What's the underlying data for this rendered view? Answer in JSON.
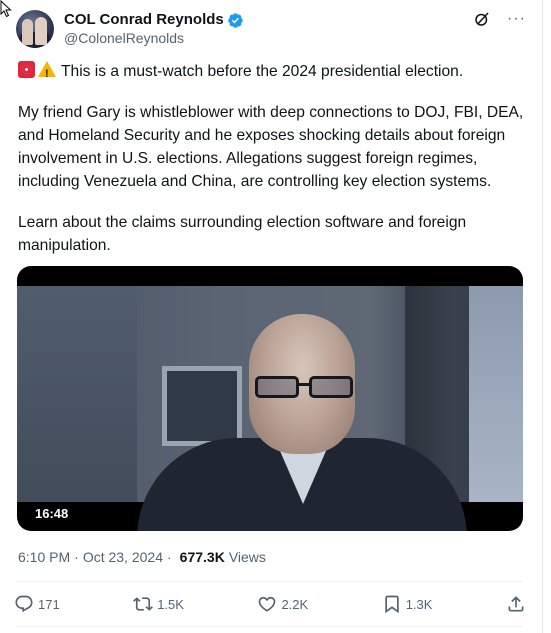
{
  "author": {
    "display_name": "COL Conrad Reynolds",
    "handle": "@ColonelReynolds"
  },
  "header_icons": [
    "grok-icon",
    "more-icon"
  ],
  "tweet": {
    "paragraph_1": "This is a must-watch before the 2024 presidential election.",
    "paragraph_2": "My friend Gary is whistleblower with deep connections to DOJ, FBI, DEA, and Homeland Security and he exposes shocking details about foreign involvement in U.S. elections. Allegations suggest foreign regimes, including Venezuela and China, are controlling key election systems.",
    "paragraph_3": "Learn about the claims surrounding election software and foreign manipulation."
  },
  "video": {
    "duration": "16:48"
  },
  "meta": {
    "time": "6:10 PM",
    "separator": "·",
    "date": "Oct 23, 2024",
    "views_count": "677.3K",
    "views_label": "Views"
  },
  "actions": {
    "replies": "171",
    "reposts": "1.5K",
    "likes": "2.2K",
    "bookmarks": "1.3K"
  },
  "colors": {
    "verified": "#1d9bf0",
    "text": "#0f1419",
    "secondary": "#536471"
  },
  "more_label": "···"
}
